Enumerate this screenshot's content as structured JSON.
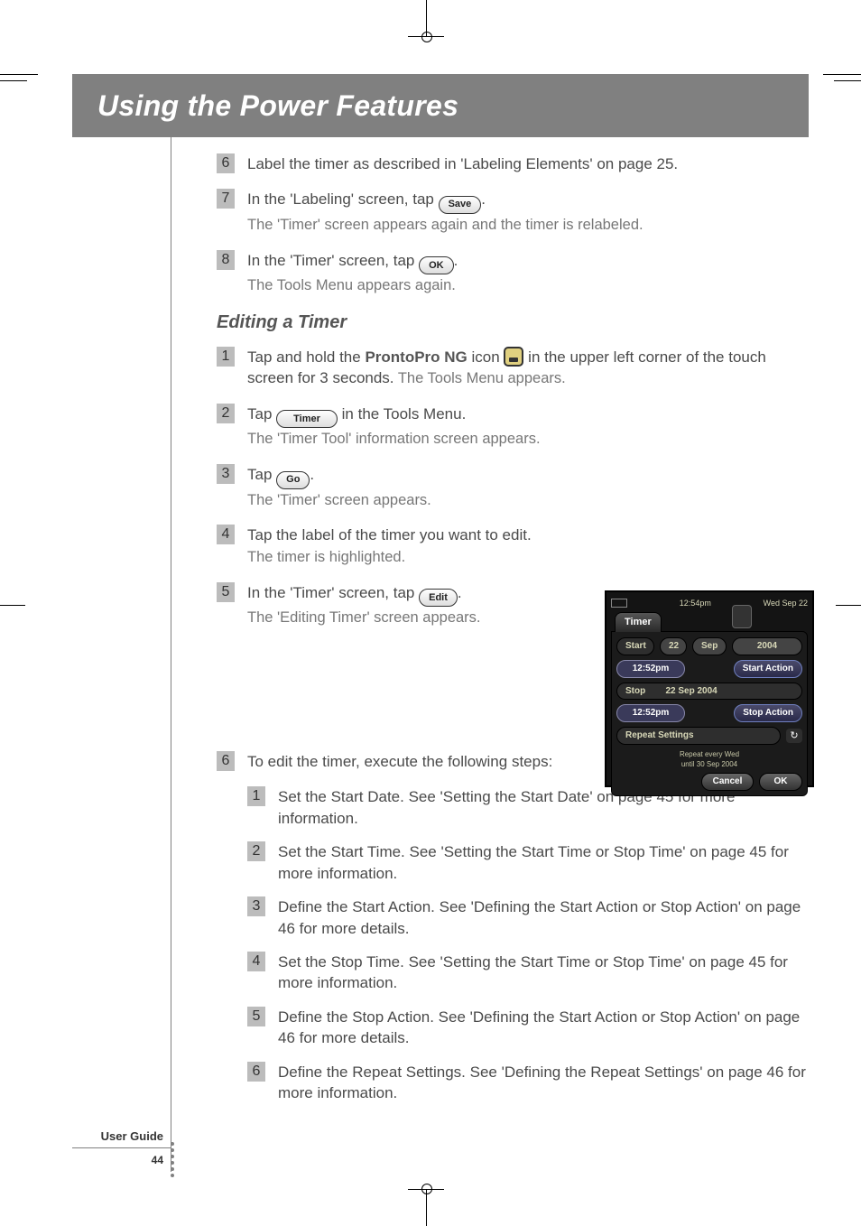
{
  "header": {
    "title": "Using the Power Features"
  },
  "footer": {
    "guide": "User Guide",
    "page": "44"
  },
  "continued_steps": [
    {
      "n": "6",
      "lead": "Label the timer as described in 'Labeling Elements' on page 25."
    },
    {
      "n": "7",
      "lead_pre": "In the 'Labeling' screen, tap ",
      "btn": "Save",
      "lead_post": ".",
      "sub": "The 'Timer' screen appears again and the timer is relabeled."
    },
    {
      "n": "8",
      "lead_pre": "In the 'Timer' screen, tap ",
      "btn": "OK",
      "lead_post": ".",
      "sub": "The Tools Menu appears again."
    }
  ],
  "section": {
    "title": "Editing a Timer"
  },
  "edit_steps": [
    {
      "n": "1",
      "lead_pre": "Tap and hold the ",
      "bold": "ProntoPro NG",
      "lead_mid": " icon ",
      "icon": true,
      "lead_post": " in the upper left corner of the touch screen for 3 seconds.",
      "sub_inline": " The Tools Menu appears."
    },
    {
      "n": "2",
      "lead_pre": "Tap ",
      "btn": "Timer",
      "btn_wide": true,
      "lead_post": " in the Tools Menu.",
      "sub": "The 'Timer Tool' information screen appears."
    },
    {
      "n": "3",
      "lead_pre": "Tap ",
      "btn": "Go",
      "lead_post": ".",
      "sub": "The 'Timer' screen appears."
    },
    {
      "n": "4",
      "lead": "Tap the label of the timer you want to edit.",
      "sub": "The timer is highlighted."
    },
    {
      "n": "5",
      "lead_pre": "In the 'Timer' screen, tap ",
      "btn": "Edit",
      "lead_post": ".",
      "sub": "The 'Editing Timer' screen appears."
    },
    {
      "n": "6",
      "lead": "To edit the timer, execute the following steps:"
    }
  ],
  "sub_steps": [
    {
      "n": "1",
      "text": "Set the Start Date. See 'Setting the Start Date' on page 45 for more information."
    },
    {
      "n": "2",
      "text": "Set the Start Time. See 'Setting the Start Time or Stop Time' on page 45 for more information."
    },
    {
      "n": "3",
      "text": "Define the Start Action. See 'Defining the Start Action or Stop Action' on page 46 for more details."
    },
    {
      "n": "4",
      "text": "Set the Stop Time. See 'Setting the Start Time or Stop Time' on page 45 for more information."
    },
    {
      "n": "5",
      "text": "Define the Stop Action. See 'Defining the Start Action or Stop Action' on page 46 for more details."
    },
    {
      "n": "6",
      "text": "Define the Repeat Settings. See 'Defining the Repeat Settings' on page 46 for more information."
    }
  ],
  "device": {
    "clock": "12:54pm",
    "date": "Wed Sep 22",
    "tab": "Timer",
    "start_label": "Start",
    "start_day": "22",
    "start_month": "Sep",
    "start_year": "2004",
    "start_time": "12:52pm",
    "start_action": "Start Action",
    "stop_label": "Stop",
    "stop_date": "22 Sep 2004",
    "stop_time": "12:52pm",
    "stop_action": "Stop Action",
    "repeat_label": "Repeat Settings",
    "repeat_detail": "Repeat every Wed\nuntil 30 Sep 2004",
    "cancel": "Cancel",
    "ok": "OK"
  }
}
